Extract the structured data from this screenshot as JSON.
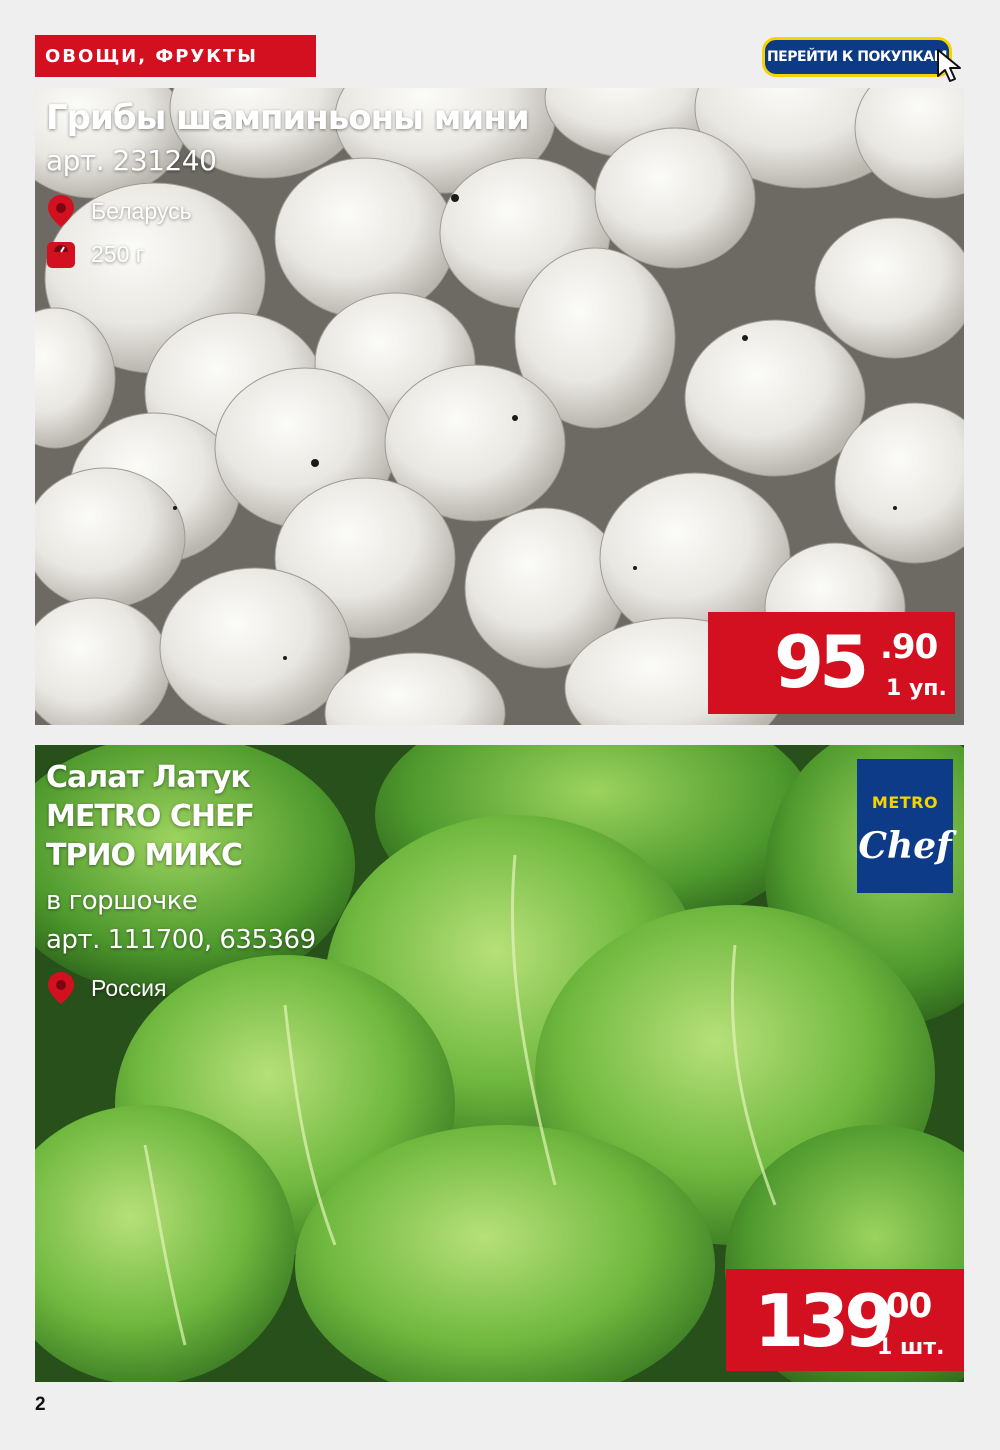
{
  "header": {
    "category": "ОВОЩИ, ФРУКТЫ",
    "shop_button": "ПЕРЕЙТИ К ПОКУПКАМ"
  },
  "products": [
    {
      "title": "Грибы шампиньоны мини",
      "article": "арт. 231240",
      "origin": "Беларусь",
      "weight": "250 г",
      "price_int": "95",
      "price_dec": ".90",
      "price_unit": "1 уп.",
      "icons": [
        "location-pin-icon",
        "weight-icon"
      ]
    },
    {
      "title_lines": [
        "Салат Латук",
        "METRO CHEF",
        "ТРИО МИКС"
      ],
      "subtitle": "в горшочке",
      "article": "арт. 111700, 635369",
      "origin": "Россия",
      "price_int": "139",
      "price_dec": ".00",
      "price_unit": "1 шт.",
      "brand": {
        "line1": "METRO",
        "line2": "Chef"
      },
      "icons": [
        "location-pin-icon"
      ]
    }
  ],
  "colors": {
    "accent_red": "#d2101f",
    "brand_blue": "#0e3b87",
    "brand_yellow": "#f4d300"
  },
  "page_number": "2"
}
